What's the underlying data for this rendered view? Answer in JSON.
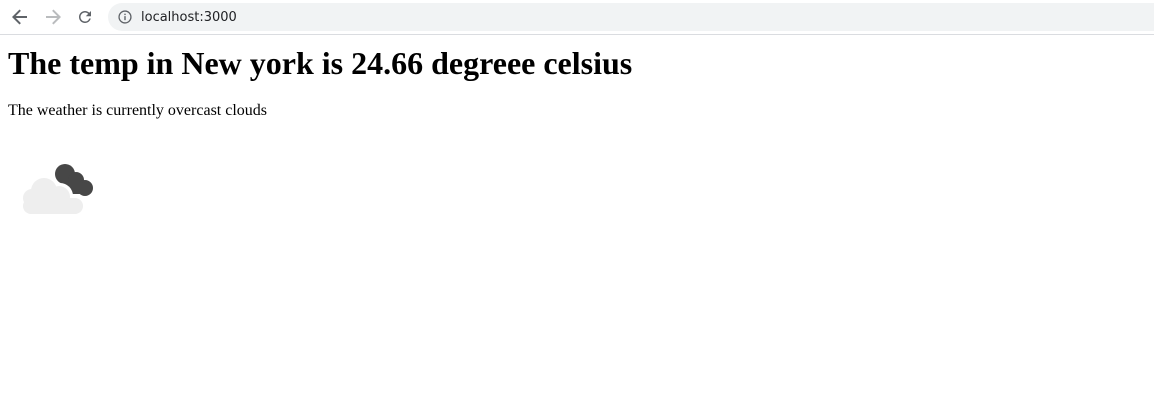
{
  "browser": {
    "url": "localhost:3000",
    "back_icon": "arrow-left-icon",
    "forward_icon": "arrow-right-icon",
    "reload_icon": "reload-icon",
    "site_info_icon": "info-icon"
  },
  "main": {
    "heading": "The temp in New york is 24.66 degreee celsius",
    "description": "The weather is currently overcast clouds",
    "weather_icon": "overcast-clouds-icon"
  },
  "colors": {
    "omnibox_bg": "#f1f3f4",
    "icon_dark": "#5f6368",
    "icon_disabled": "#babcbe",
    "cloud_light": "#eeeeee",
    "cloud_dark": "#474747"
  }
}
